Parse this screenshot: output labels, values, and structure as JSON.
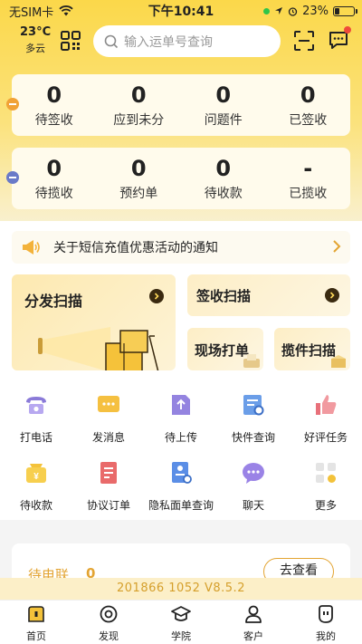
{
  "status_bar": {
    "carrier": "无SIM卡",
    "time": "下午10:41",
    "battery": "23%"
  },
  "header": {
    "temperature": "23°C",
    "weather": "多云",
    "search_placeholder": "输入运单号查询"
  },
  "stats_row1": [
    {
      "value": "0",
      "label": "待签收"
    },
    {
      "value": "0",
      "label": "应到未分"
    },
    {
      "value": "0",
      "label": "问题件"
    },
    {
      "value": "0",
      "label": "已签收"
    }
  ],
  "stats_row2": [
    {
      "value": "0",
      "label": "待揽收"
    },
    {
      "value": "0",
      "label": "预约单"
    },
    {
      "value": "0",
      "label": "待收款"
    },
    {
      "value": "-",
      "label": "已揽收"
    }
  ],
  "notice": {
    "text": "关于短信充值优惠活动的通知"
  },
  "tiles": {
    "dispatch_scan": "分发扫描",
    "sign_scan": "签收扫描",
    "onsite_print": "现场打单",
    "pickup_scan": "揽件扫描"
  },
  "grid": [
    {
      "label": "打电话",
      "icon": "phone-icon"
    },
    {
      "label": "发消息",
      "icon": "message-icon"
    },
    {
      "label": "待上传",
      "icon": "upload-icon"
    },
    {
      "label": "快件查询",
      "icon": "query-icon"
    },
    {
      "label": "好评任务",
      "icon": "thumbs-up-icon"
    },
    {
      "label": "待收款",
      "icon": "wallet-icon"
    },
    {
      "label": "协议订单",
      "icon": "contract-icon"
    },
    {
      "label": "隐私面单查询",
      "icon": "privacy-icon"
    },
    {
      "label": "聊天",
      "icon": "chat-icon"
    },
    {
      "label": "更多",
      "icon": "more-icon"
    }
  ],
  "pending": {
    "title": "待电联",
    "count": "0",
    "button": "去查看"
  },
  "version": {
    "text": "201866  1052  V8.5.2"
  },
  "tabbar": [
    {
      "label": "首页",
      "icon": "home-icon"
    },
    {
      "label": "发现",
      "icon": "discover-icon"
    },
    {
      "label": "学院",
      "icon": "academy-icon"
    },
    {
      "label": "客户",
      "icon": "customer-icon"
    },
    {
      "label": "我的",
      "icon": "profile-icon"
    }
  ],
  "colors": {
    "brand_yellow": "#fbd84a",
    "accent_orange": "#e3a432"
  }
}
